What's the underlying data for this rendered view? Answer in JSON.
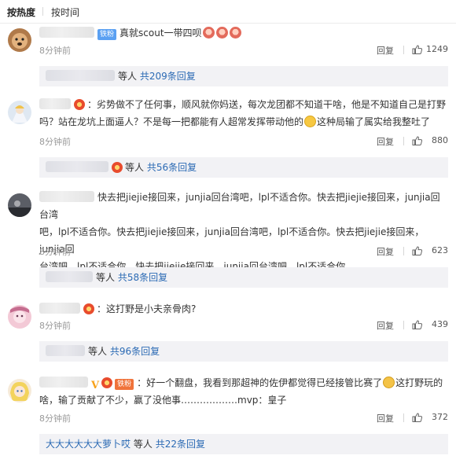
{
  "sort": {
    "hot": "按热度",
    "time": "按时间"
  },
  "comments": [
    {
      "badge": "铁粉",
      "text": "真就scout一带四呗",
      "time": "8分钟前",
      "reply": "回复",
      "likes": "1249",
      "sub": {
        "suffix": "等人",
        "link": "共209条回复"
      }
    },
    {
      "line1": "劣势做不了任何事，顺风就你妈送，每次龙团都不知道干啥，他是不知道自己是打野",
      "line2": "吗？站在龙坑上面逼人？不是每一把都能有人超常发挥带动他的",
      "line2b": "这种局输了属实给我整吐了",
      "time": "8分钟前",
      "reply": "回复",
      "likes": "880",
      "sub": {
        "suffix": "等人",
        "link": "共56条回复"
      }
    },
    {
      "line1": "快去把jiejie接回来，junjia回台湾吧，lpl不适合你。快去把jiejie接回来，junjia回台湾",
      "line2": "吧，lpl不适合你。快去把jiejie接回来，junjia回台湾吧，lpl不适合你。快去把jiejie接回来，junjia回",
      "line3": "台湾吧，lpl不适合你。快去把jiejie接回来，junjia回台湾吧，lpl不适合你。",
      "time": "8分钟前",
      "reply": "回复",
      "likes": "623",
      "sub": {
        "suffix": "等人",
        "link": "共58条回复"
      }
    },
    {
      "text": "这打野是小夫亲骨肉?",
      "time": "8分钟前",
      "reply": "回复",
      "likes": "439",
      "sub": {
        "suffix": "等人",
        "link": "共96条回复"
      }
    },
    {
      "badge": "铁粉",
      "line1a": "好一个翻盘，我看到那超神的佐伊都觉得已经接管比赛了",
      "line1b": "这打野玩的",
      "line2": "啥，输了贡献了不少，赢了没他事………………mvp：皇子",
      "time": "8分钟前",
      "reply": "回复",
      "likes": "372",
      "sub": {
        "names": "大大大大大大萝卜哎",
        "suffix": "等人",
        "link": "共22条回复"
      }
    }
  ]
}
